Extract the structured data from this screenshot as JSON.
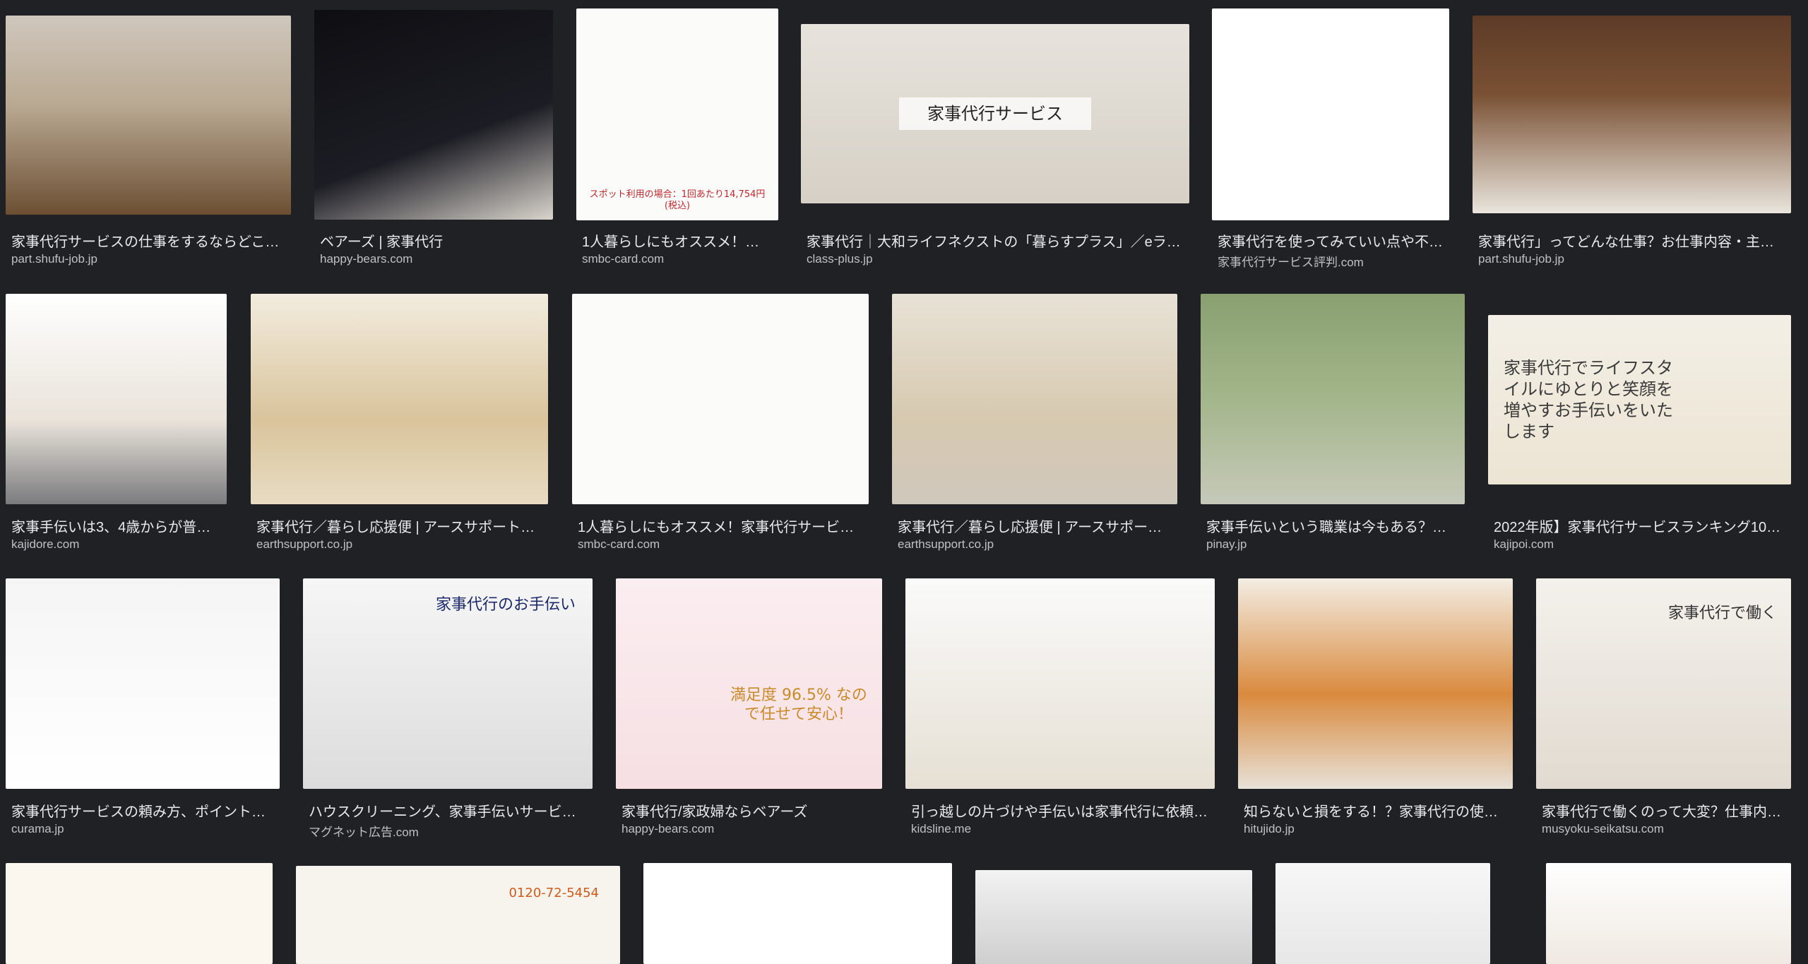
{
  "results": [
    {
      "title": "家事代行サービスの仕事をするならどこ…",
      "domain": "part.shufu-job.jp",
      "thumb_text": ""
    },
    {
      "title": "ベアーズ | 家事代行",
      "domain": "happy-bears.com",
      "thumb_text": ""
    },
    {
      "title": "1人暮らしにもオススメ！家…",
      "domain": "smbc-card.com",
      "thumb_text": "スポット利用の場合：1回あたり14,754円(税込)"
    },
    {
      "title": "家事代行｜大和ライフネクストの「暮らすプラス」／eラ…",
      "domain": "class-plus.jp",
      "thumb_text": "家事代行サービス"
    },
    {
      "title": "家事代行を使ってみていい点や不…",
      "domain": "家事代行サービス評判.com",
      "thumb_text": ""
    },
    {
      "title": "家事代行」ってどんな仕事？お仕事内容・主…",
      "domain": "part.shufu-job.jp",
      "thumb_text": ""
    },
    {
      "title": "家事手伝いは3、4歳からが普…",
      "domain": "kajidore.com",
      "thumb_text": ""
    },
    {
      "title": "家事代行／暮らし応援便 | アースサポート…",
      "domain": "earthsupport.co.jp",
      "thumb_text": ""
    },
    {
      "title": "1人暮らしにもオススメ！家事代行サービ…",
      "domain": "smbc-card.com",
      "thumb_text": ""
    },
    {
      "title": "家事代行／暮らし応援便 | アースサポー…",
      "domain": "earthsupport.co.jp",
      "thumb_text": ""
    },
    {
      "title": "家事手伝いという職業は今もある？家…",
      "domain": "pinay.jp",
      "thumb_text": ""
    },
    {
      "title": "2022年版】家事代行サービスランキング10…",
      "domain": "kajipoi.com",
      "thumb_text": "家事代行でライフスタイルにゆとりと笑顔を増やすお手伝いをいたします"
    },
    {
      "title": "家事代行サービスの頼み方、ポイント…",
      "domain": "curama.jp",
      "thumb_text": ""
    },
    {
      "title": "ハウスクリーニング、家事手伝いサービス…",
      "domain": "マグネット広告.com",
      "thumb_text": "家事代行のお手伝い"
    },
    {
      "title": "家事代行/家政婦ならベアーズ",
      "domain": "happy-bears.com",
      "thumb_text": "満足度 96.5% なので任せて安心！"
    },
    {
      "title": "引っ越しの片づけや手伝いは家事代行に依頼…",
      "domain": "kidsline.me",
      "thumb_text": ""
    },
    {
      "title": "知らないと損をする！？家事代行の使…",
      "domain": "hitujido.jp",
      "thumb_text": ""
    },
    {
      "title": "家事代行で働くのって大変？仕事内…",
      "domain": "musyoku-seikatsu.com",
      "thumb_text": "家事代行で働く"
    },
    {
      "title": "",
      "domain": "",
      "thumb_text": ""
    },
    {
      "title": "",
      "domain": "",
      "thumb_text": "0120-72-5454"
    },
    {
      "title": "",
      "domain": "",
      "thumb_text": ""
    },
    {
      "title": "",
      "domain": "",
      "thumb_text": ""
    },
    {
      "title": "",
      "domain": "",
      "thumb_text": ""
    },
    {
      "title": "",
      "domain": "",
      "thumb_text": ""
    }
  ]
}
